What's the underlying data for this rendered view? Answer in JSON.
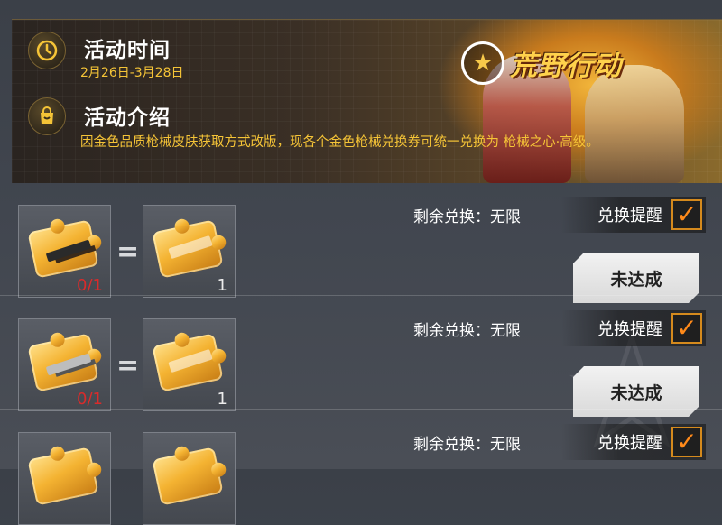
{
  "banner": {
    "activity_time_label": "活动时间",
    "activity_date": "2月26日-3月28日",
    "activity_intro_label": "活动介绍",
    "activity_desc": "因金色品质枪械皮肤获取方式改版，现各个金色枪械兑换券可统一兑换为 枪械之心·高级。",
    "logo_text": "荒野行动",
    "icons": [
      "clock-icon",
      "shopping-bag-icon",
      "star-logo-icon"
    ]
  },
  "rows": [
    {
      "src_count": "0/1",
      "dst_count": "1",
      "remain_label": "剩余兑换：无限",
      "reminder_label": "兑换提醒",
      "reminder_checked": true,
      "button_label": "未达成"
    },
    {
      "src_count": "0/1",
      "dst_count": "1",
      "remain_label": "剩余兑换：无限",
      "reminder_label": "兑换提醒",
      "reminder_checked": true,
      "button_label": "未达成"
    },
    {
      "src_count": "",
      "dst_count": "",
      "remain_label": "剩余兑换：无限",
      "reminder_label": "兑换提醒",
      "reminder_checked": true,
      "button_label": ""
    }
  ],
  "symbols": {
    "equals": "=",
    "check": "✓"
  },
  "colors": {
    "accent_gold": "#f5c437",
    "check_orange": "#ff8a1a",
    "count_red": "#d92b2b"
  }
}
